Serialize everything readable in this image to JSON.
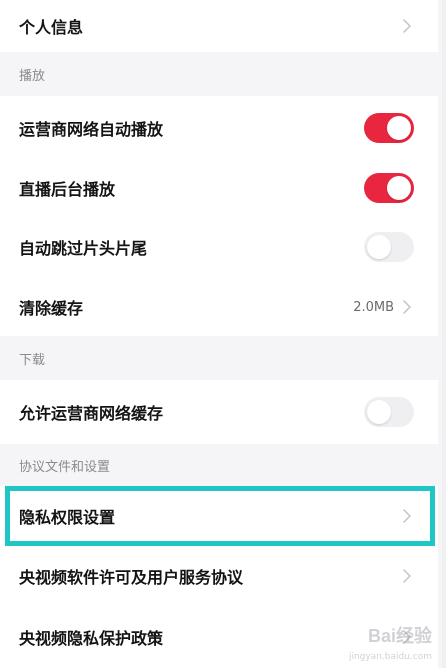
{
  "rows": {
    "personal_info": {
      "label": "个人信息"
    },
    "carrier_autoplay": {
      "label": "运营商网络自动播放",
      "toggle": "on"
    },
    "background_play": {
      "label": "直播后台播放",
      "toggle": "on"
    },
    "skip_intro": {
      "label": "自动跳过片头片尾",
      "toggle": "off"
    },
    "clear_cache": {
      "label": "清除缓存",
      "value": "2.0MB"
    },
    "carrier_cache": {
      "label": "允许运营商网络缓存",
      "toggle": "off"
    },
    "privacy_settings": {
      "label": "隐私权限设置"
    },
    "license_agreement": {
      "label": "央视频软件许可及用户服务协议"
    },
    "privacy_policy": {
      "label": "央视频隐私保护政策"
    }
  },
  "sections": {
    "playback": "播放",
    "download": "下载",
    "agreements": "协议文件和设置"
  },
  "watermark": {
    "text": "Bai经验",
    "sub": "jingyan.baidu.com"
  },
  "colors": {
    "toggle_on": "#e8263f",
    "toggle_off": "#efeff1",
    "highlight": "#1ec6c8",
    "section_bg": "#f5f5f7"
  },
  "icons": {
    "chevron": "chevron-right-icon"
  }
}
